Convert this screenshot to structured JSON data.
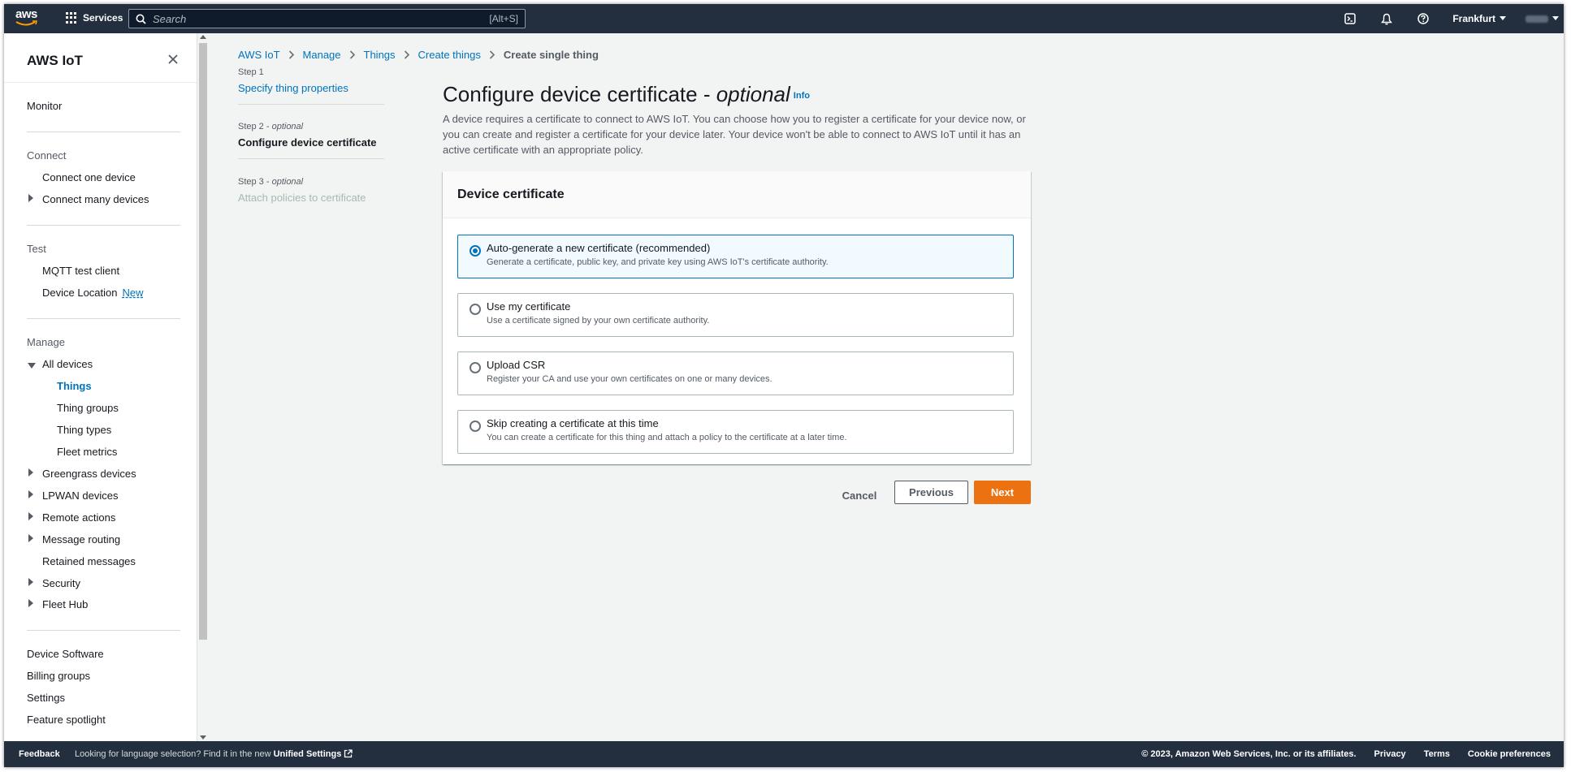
{
  "topnav": {
    "logo_text": "aws",
    "services_label": "Services",
    "search_placeholder": "Search",
    "search_hint": "[Alt+S]",
    "region": "Frankfurt"
  },
  "sidebar": {
    "title": "AWS IoT",
    "monitor": "Monitor",
    "connect_section": "Connect",
    "connect_one": "Connect one device",
    "connect_many": "Connect many devices",
    "test_section": "Test",
    "mqtt": "MQTT test client",
    "device_location": "Device Location",
    "new_badge": "New",
    "manage_section": "Manage",
    "all_devices": "All devices",
    "things": "Things",
    "thing_groups": "Thing groups",
    "thing_types": "Thing types",
    "fleet_metrics": "Fleet metrics",
    "greengrass": "Greengrass devices",
    "lpwan": "LPWAN devices",
    "remote_actions": "Remote actions",
    "message_routing": "Message routing",
    "retained_messages": "Retained messages",
    "security": "Security",
    "fleet_hub": "Fleet Hub",
    "device_software": "Device Software",
    "billing_groups": "Billing groups",
    "settings": "Settings",
    "feature_spotlight": "Feature spotlight"
  },
  "breadcrumb": {
    "items": [
      "AWS IoT",
      "Manage",
      "Things",
      "Create things"
    ],
    "current": "Create single thing"
  },
  "steps": [
    {
      "label": "Step 1",
      "qualifier": "",
      "name": "Specify thing properties"
    },
    {
      "label": "Step 2 - ",
      "qualifier": "optional",
      "name": "Configure device certificate"
    },
    {
      "label": "Step 3 - ",
      "qualifier": "optional",
      "name": "Attach policies to certificate"
    }
  ],
  "page": {
    "title": "Configure device certificate - ",
    "title_optional": "optional",
    "info": "Info",
    "description": "A device requires a certificate to connect to AWS IoT. You can choose how you to register a certificate for your device now, or you can create and register a certificate for your device later. Your device won't be able to connect to AWS IoT until it has an active certificate with an appropriate policy."
  },
  "panel": {
    "title": "Device certificate",
    "options": [
      {
        "title": "Auto-generate a new certificate (recommended)",
        "desc": "Generate a certificate, public key, and private key using AWS IoT's certificate authority.",
        "selected": true
      },
      {
        "title": "Use my certificate",
        "desc": "Use a certificate signed by your own certificate authority.",
        "selected": false
      },
      {
        "title": "Upload CSR",
        "desc": "Register your CA and use your own certificates on one or many devices.",
        "selected": false
      },
      {
        "title": "Skip creating a certificate at this time",
        "desc": "You can create a certificate for this thing and attach a policy to the certificate at a later time.",
        "selected": false
      }
    ]
  },
  "buttons": {
    "cancel": "Cancel",
    "previous": "Previous",
    "next": "Next"
  },
  "footer": {
    "feedback": "Feedback",
    "lang_text": "Looking for language selection? Find it in the new ",
    "lang_link": "Unified Settings",
    "copyright": "© 2023, Amazon Web Services, Inc. or its affiliates.",
    "privacy": "Privacy",
    "terms": "Terms",
    "cookies": "Cookie preferences"
  },
  "colors": {
    "nav_bg": "#232f3e",
    "link": "#0073bb",
    "primary_button": "#ec7211"
  }
}
